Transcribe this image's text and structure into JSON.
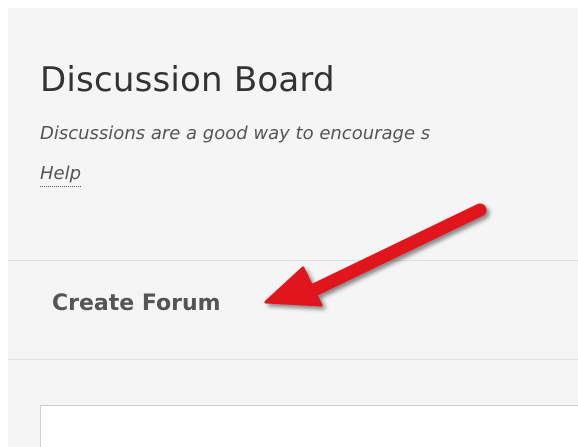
{
  "page": {
    "title": "Discussion Board",
    "description": "Discussions are a good way to encourage s",
    "help_label": "Help"
  },
  "action_bar": {
    "create_forum_label": "Create Forum"
  },
  "annotation": {
    "arrow_color": "#e0121a",
    "icon": "red-arrow-pointing-to-create-forum"
  }
}
